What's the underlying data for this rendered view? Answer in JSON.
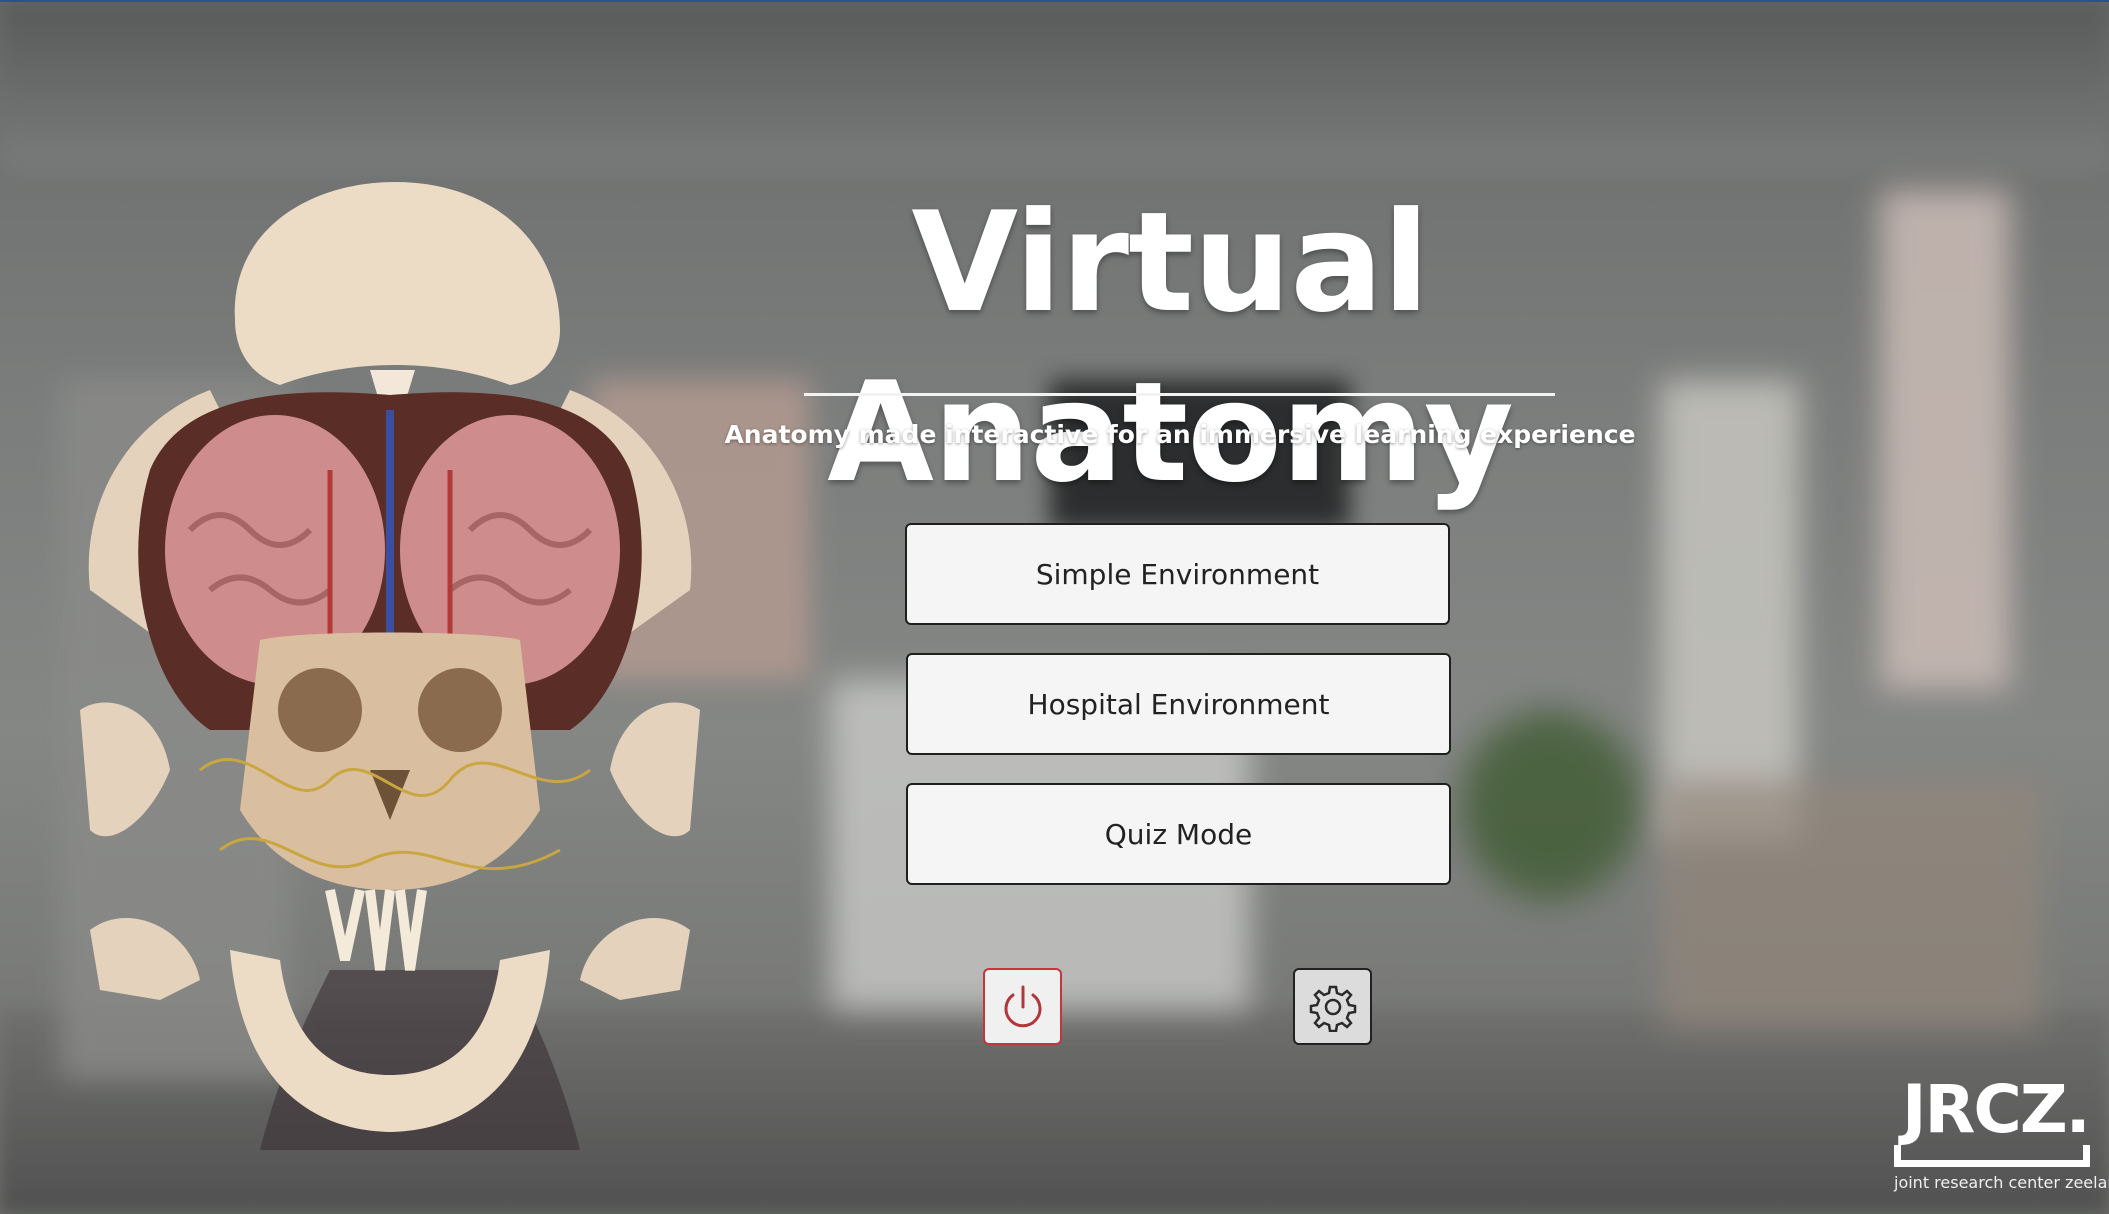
{
  "app": {
    "title": "Virtual Anatomy",
    "subtitle": "Anatomy made interactive for an immersive learning experience"
  },
  "menu": {
    "items": [
      {
        "label": "Simple Environment"
      },
      {
        "label": "Hospital Environment"
      },
      {
        "label": "Quiz Mode"
      }
    ]
  },
  "controls": {
    "power_icon": "power-icon",
    "settings_icon": "gear-icon",
    "power_border_color": "#c0383c"
  },
  "logo": {
    "word": "JRCZ.",
    "tagline": "joint research center zeeland"
  }
}
